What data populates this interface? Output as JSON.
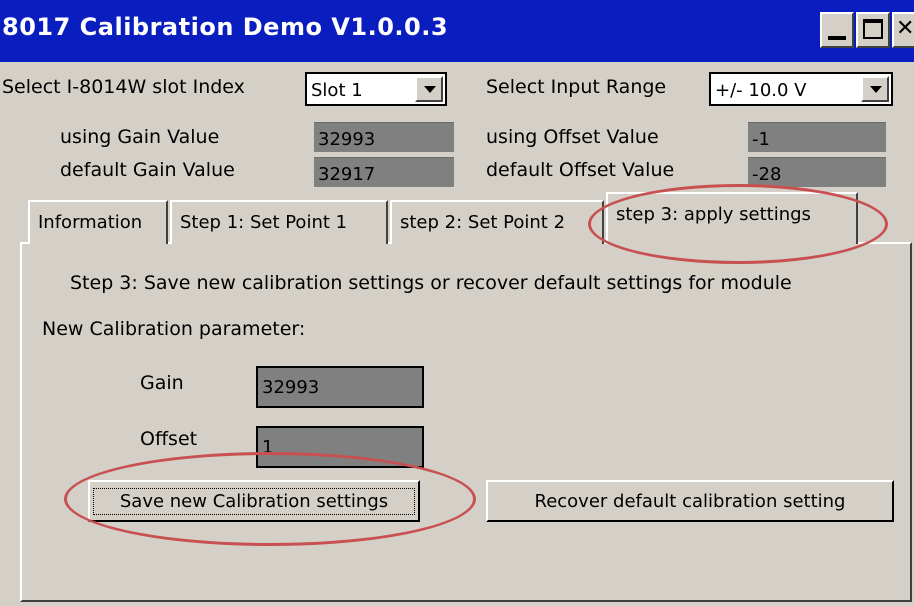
{
  "window": {
    "title": "8017 Calibration Demo V1.0.0.3"
  },
  "slot": {
    "label": "Select I-8014W slot Index",
    "value": "Slot 1"
  },
  "range": {
    "label": "Select Input Range",
    "value": "+/- 10.0 V"
  },
  "gain": {
    "using_label": "using Gain Value",
    "using_value": "32993",
    "default_label": "default Gain Value",
    "default_value": "32917"
  },
  "offset": {
    "using_label": "using Offset Value",
    "using_value": "-1",
    "default_label": "default Offset Value",
    "default_value": "-28"
  },
  "tabs": [
    {
      "label": "Information"
    },
    {
      "label": "Step 1: Set Point 1"
    },
    {
      "label": "step 2: Set Point 2"
    },
    {
      "label": "step 3: apply settings"
    }
  ],
  "step3": {
    "heading": "Step 3: Save new calibration settings or recover default settings for module",
    "param_label": "New Calibration parameter:",
    "gain_label": "Gain",
    "gain_value": "32993",
    "offset_label": "Offset",
    "offset_value": "1",
    "save_button": "Save new Calibration settings",
    "recover_button": "Recover default calibration setting"
  },
  "colors": {
    "titlebar": "#0a1ec0",
    "face": "#d4d0c8",
    "readonly": "#808080",
    "annotation": "#c85050"
  }
}
